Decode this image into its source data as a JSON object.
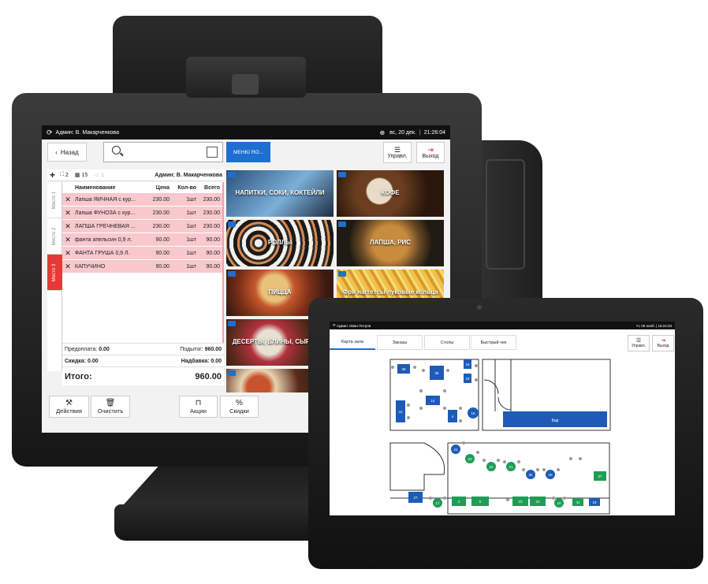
{
  "pos": {
    "status": {
      "admin": "Админ: В. Макарченкова",
      "date": "вс, 20 дек.",
      "separator": "|",
      "time": "21:26:04"
    },
    "back_label": "Назад",
    "menu_tab_label": "МЕНЮ RO...",
    "manage_label": "Управл.",
    "exit_label": "Выход",
    "order_header": {
      "guests": "2",
      "table": "15",
      "persons": "1",
      "admin": "Админ: В. Макарченкова"
    },
    "seats": [
      "Место 1",
      "Место 2",
      "Место 3"
    ],
    "columns": {
      "name": "Наименование",
      "price": "Цена",
      "qty": "Кол-во",
      "total": "Всего"
    },
    "rows": [
      {
        "name": "Лапша ЯИЧНАЯ с кур...",
        "price": "230.00",
        "qty": "1шт",
        "total": "230.00"
      },
      {
        "name": "Лапша ФУНОЗА с кур...",
        "price": "230.00",
        "qty": "1шт",
        "total": "230.00"
      },
      {
        "name": "ЛАПША ГРЕЧНЕВАЯ ...",
        "price": "230.00",
        "qty": "1шт",
        "total": "230.00"
      },
      {
        "name": "фанта апельсин 0,9 л.",
        "price": "90.00",
        "qty": "1шт",
        "total": "90.00"
      },
      {
        "name": "ФАНТА ГРУША 0,9 Л.",
        "price": "90.00",
        "qty": "1шт",
        "total": "90.00"
      },
      {
        "name": "КАПУЧИНО",
        "price": "90.00",
        "qty": "1шт",
        "total": "90.00"
      }
    ],
    "totals": {
      "prepay_label": "Предоплата:",
      "prepay_value": "0.00",
      "subtotal_label": "Подытог:",
      "subtotal_value": "960.00",
      "discount_label": "Скидка:",
      "discount_value": "0.00",
      "markup_label": "Надбавка:",
      "markup_value": "0.00",
      "total_label": "Итого:",
      "total_value": "960.00"
    },
    "buttons": {
      "actions": "Действия",
      "clear": "Очистить",
      "promos": "Акции",
      "discounts": "Скидки"
    },
    "tiles": [
      {
        "label": "НАПИТКИ, СОКИ, КОКТЕЙЛИ"
      },
      {
        "label": "КОФЕ"
      },
      {
        "label": "РОЛЛЫ"
      },
      {
        "label": "ЛАПША, РИС"
      },
      {
        "label": "ПИЦЦА"
      },
      {
        "label": "Фри наггетсы луковые кольца"
      },
      {
        "label": "ДЕСЕРТЫ, БЛИНЫ, СЫРНИКИ"
      },
      {
        "label": ""
      }
    ],
    "colors": {
      "accent": "#1d6fd0",
      "row_highlight": "#f8c8cc",
      "active_seat": "#e53935"
    }
  },
  "tablet": {
    "status": {
      "admin": "Админ: Иван Петров",
      "date": "чт, 06 нояб.",
      "time": "16:24:33"
    },
    "tabs": [
      "Карта зала",
      "Заказы",
      "Столы",
      "Быстрый чек"
    ],
    "manage_label": "Управл.",
    "exit_label": "Выход",
    "bar_label": "Бар",
    "tables": [
      "38",
      "36",
      "16",
      "19",
      "41",
      "14",
      "16",
      "4",
      "24",
      "20",
      "22",
      "21",
      "30",
      "20",
      "37",
      "27",
      "17",
      "2",
      "5",
      "23",
      "24",
      "10",
      "41",
      "18"
    ],
    "colors": {
      "occupied": "#1e5bb8",
      "free": "#1f9d55",
      "bar": "#1e5bb8"
    }
  }
}
